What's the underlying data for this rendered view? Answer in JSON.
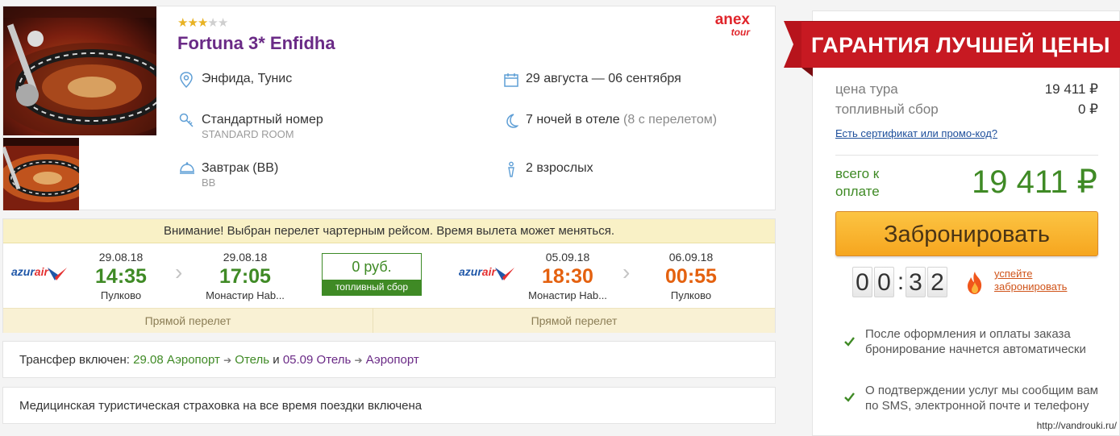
{
  "hotel": {
    "stars_filled": 3,
    "stars_total": 5,
    "name": "Fortuna 3* Enfidha",
    "operator": {
      "brand": "anex",
      "sub": "tour"
    },
    "location": "Энфида, Тунис",
    "dates": "29 августа — 06 сентября",
    "room_type": "Стандартный номер",
    "room_type_sub": "STANDARD ROOM",
    "nights": "7 ночей в отеле",
    "nights_note": "(8 с перелетом)",
    "meal": "Завтрак (BB)",
    "meal_sub": "BB",
    "guests": "2 взрослых",
    "icons": [
      "location-icon",
      "calendar-icon",
      "key-icon",
      "moon-icon",
      "meal-icon",
      "person-icon"
    ]
  },
  "flight": {
    "warning": "Внимание! Выбран перелет чартерным рейсом. Время вылета может меняться.",
    "outbound": {
      "airline": {
        "logo_text_a": "azur",
        "logo_text_b": "air"
      },
      "depart": {
        "date": "29.08.18",
        "time": "14:35",
        "airport": "Пулково"
      },
      "arrive": {
        "date": "29.08.18",
        "time": "17:05",
        "airport": "Монастир Hab..."
      },
      "type": "Прямой перелет"
    },
    "fuel": {
      "value": "0 руб.",
      "label": "топливный сбор"
    },
    "return": {
      "airline": {
        "logo_text_a": "azur",
        "logo_text_b": "air"
      },
      "depart": {
        "date": "05.09.18",
        "time": "18:30",
        "airport": "Монастир Hab..."
      },
      "arrive": {
        "date": "06.09.18",
        "time": "00:55",
        "airport": "Пулково"
      },
      "type": "Прямой перелет"
    }
  },
  "transfer": {
    "label": "Трансфер включен:",
    "out_date": "29.08",
    "out_from": "Аэропорт",
    "out_to": "Отель",
    "and": "и",
    "ret_date": "05.09",
    "ret_from": "Отель",
    "ret_to": "Аэропорт",
    "arrow": "➔"
  },
  "insurance": "Медицинская туристическая страховка на все время поездки включена",
  "price": {
    "banner": "ГАРАНТИЯ ЛУЧШЕЙ ЦЕНЫ",
    "tour_label": "цена тура",
    "tour_value": "19 411 ₽",
    "fuel_label": "топливный сбор",
    "fuel_value": "0 ₽",
    "promo_link": "Есть сертификат или промо-код?",
    "total_label": "всего к оплате",
    "total_value": "19 411 ₽",
    "book_button": "Забронировать",
    "timer": [
      "0",
      "0",
      "3",
      "2"
    ],
    "timer_sep": ":",
    "hurry_link": "успейте забронировать",
    "notes": [
      "После оформления и оплаты заказа бронирование начнется автоматически",
      "О подтверждении услуг мы сообщим вам по SMS, электронной почте и телефону"
    ]
  },
  "watermark": "http://vandrouki.ru/",
  "colors": {
    "hotel_name": "#6a2a86",
    "accent_green": "#3f8a25",
    "accent_orange": "#e4610f",
    "banner_red": "#c71922",
    "button_orange": "#f6a61f"
  }
}
